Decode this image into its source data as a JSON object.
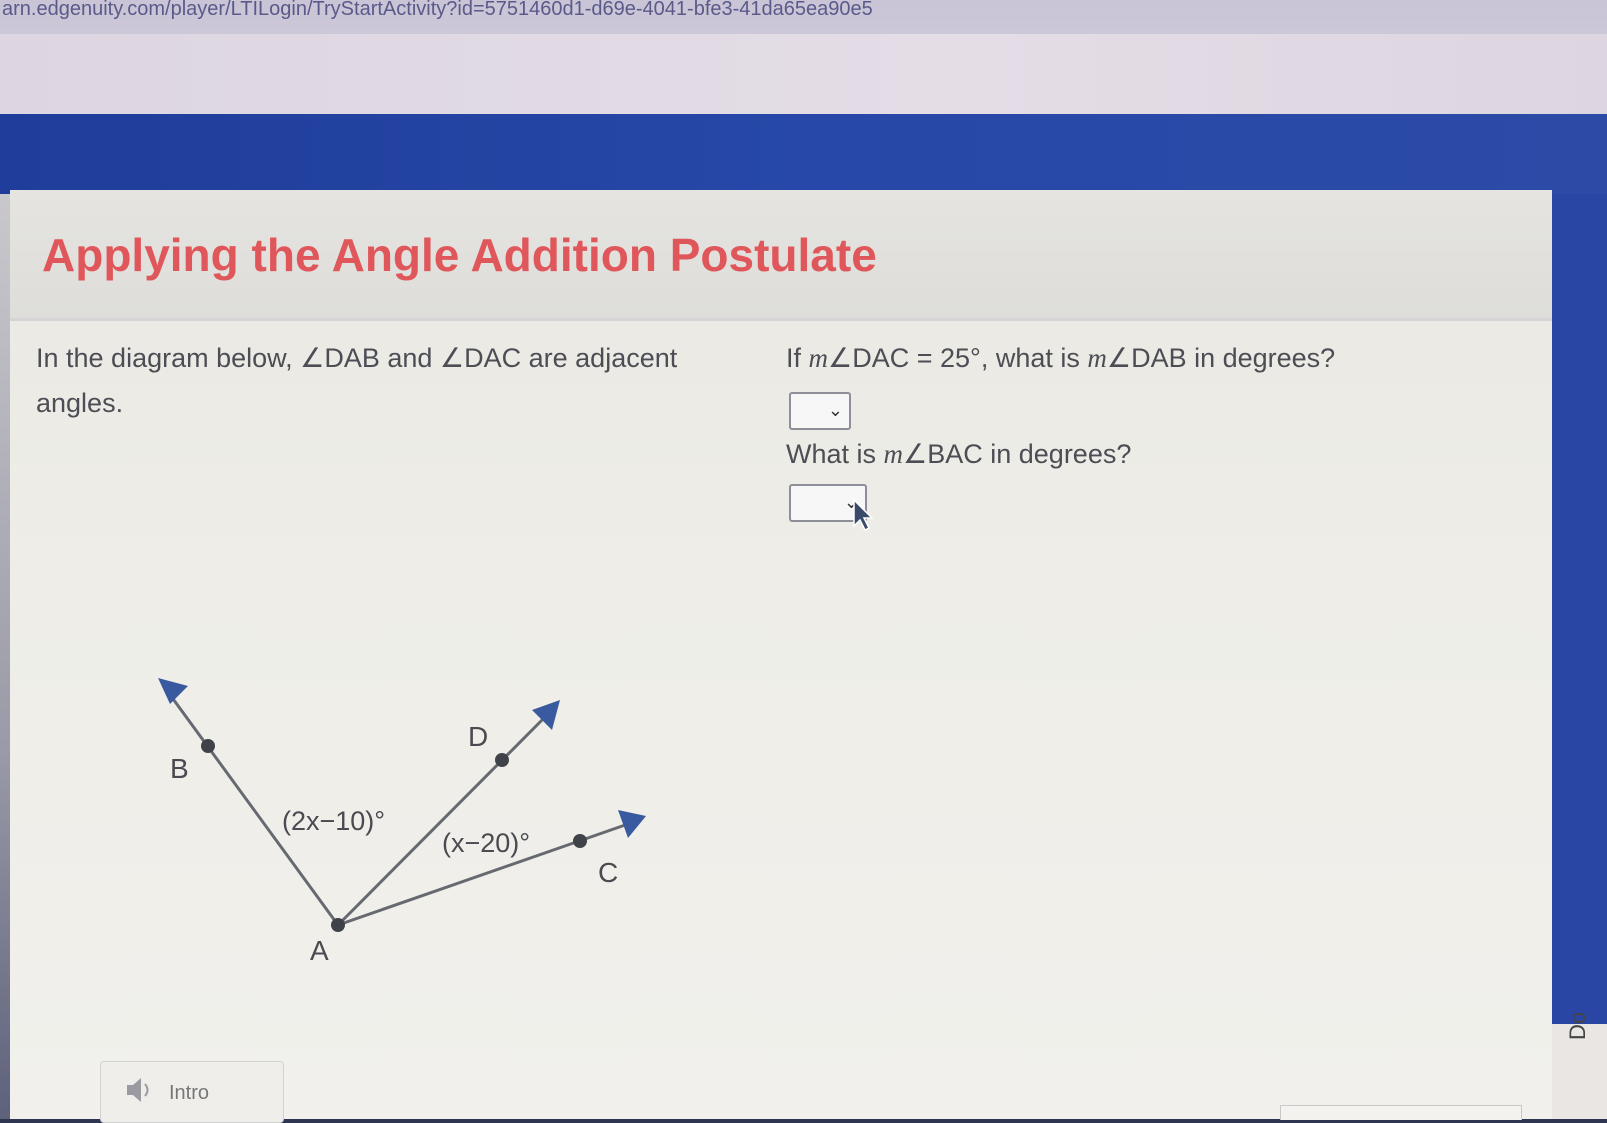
{
  "browser": {
    "url": "arn.edgenuity.com/player/LTILogin/TryStartActivity?id=5751460d1-d69e-4041-bfe3-41da65ea90e5"
  },
  "activity": {
    "title": "Applying the Angle Addition Postulate"
  },
  "question_left": {
    "line1_pre": "In the diagram below, ∠DAB and ∠DAC are adjacent",
    "line2": "angles."
  },
  "question1": {
    "pre": "If ",
    "m1": "m",
    "mid": "∠DAC = 25°, what is ",
    "m2": "m",
    "post": "∠DAB in degrees?"
  },
  "question2": {
    "pre": "What is ",
    "m": "m",
    "post": "∠BAC in degrees?"
  },
  "dropdowns": {
    "q1_value": "",
    "q2_value": "",
    "chevron": "⌄"
  },
  "diagram": {
    "point_a": "A",
    "point_b": "B",
    "point_c": "C",
    "point_d": "D",
    "angle_bad": "(2x−10)°",
    "angle_dac": "(x−20)°"
  },
  "footer": {
    "intro_label": "Intro",
    "side_text": "Do"
  },
  "colors": {
    "title": "#e0575b",
    "header_blue": "#2748a8",
    "ray_arrow": "#3a5a9f"
  }
}
